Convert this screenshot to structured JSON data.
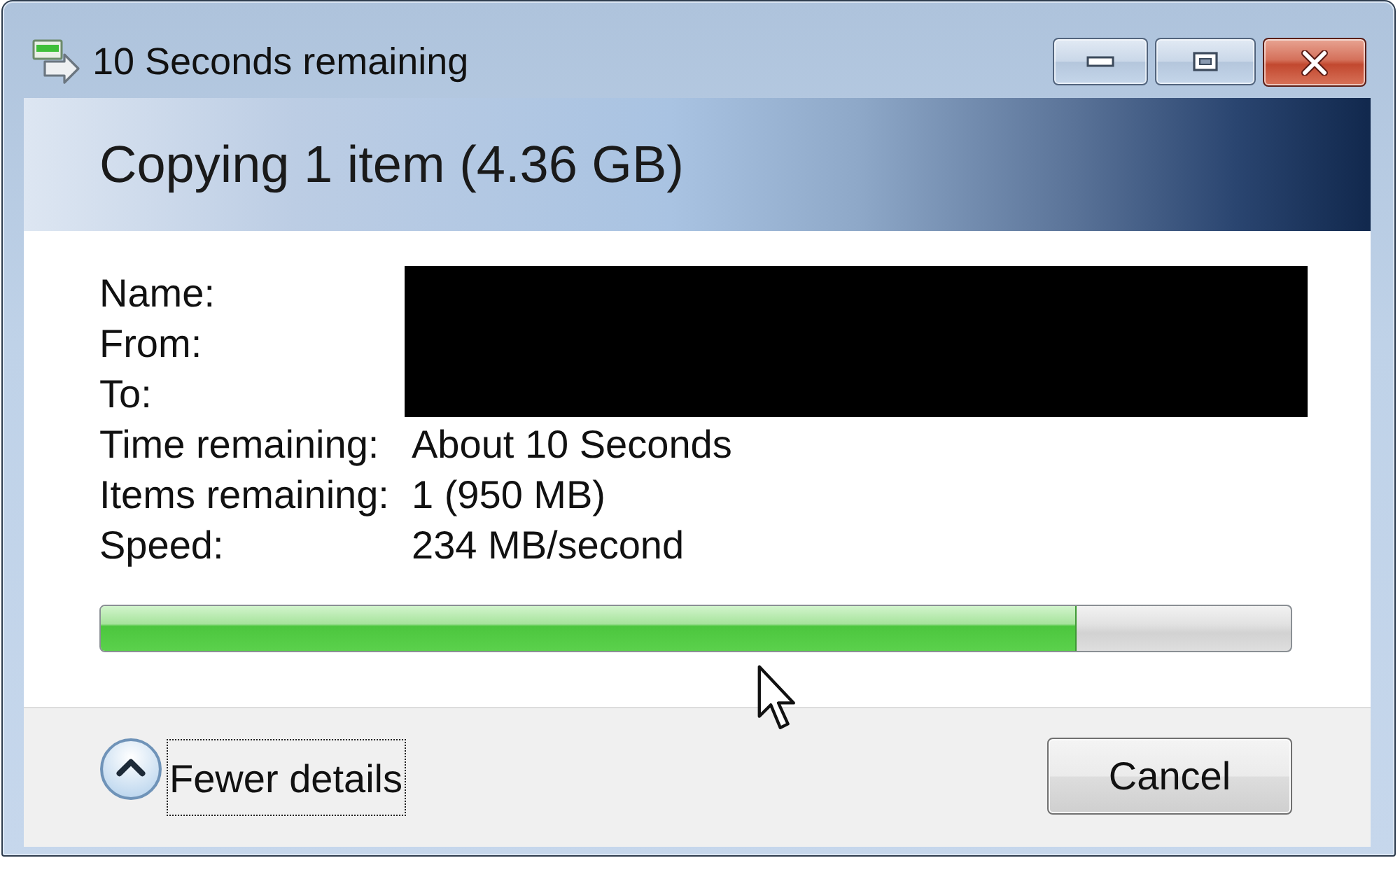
{
  "window": {
    "title": "10 Seconds remaining"
  },
  "header": {
    "title": "Copying 1 item (4.36 GB)"
  },
  "details": [
    {
      "label": "Name:",
      "redacted": true
    },
    {
      "label": "From:",
      "redacted": true
    },
    {
      "label": "To:",
      "redacted": true
    },
    {
      "label": "Time remaining:",
      "value": "About 10 Seconds",
      "redacted": false
    },
    {
      "label": "Items remaining:",
      "value": "1 (950 MB)",
      "redacted": false
    },
    {
      "label": "Speed:",
      "value": "234 MB/second",
      "redacted": false
    }
  ],
  "progress": {
    "level": 0.82
  },
  "footer": {
    "toggle": {
      "label": "Fewer details",
      "expanded": true,
      "focused": true
    },
    "buttons": [
      "Cancel"
    ]
  }
}
